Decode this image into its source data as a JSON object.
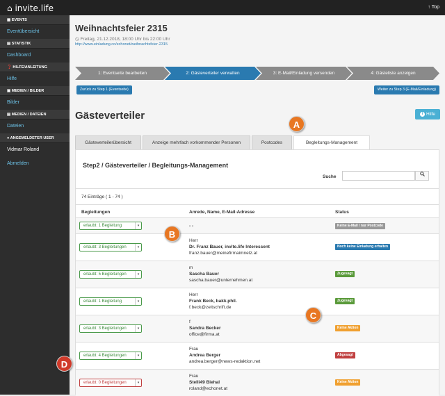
{
  "app": {
    "logo": "invite.life",
    "top_link": "Top"
  },
  "sidebar": {
    "sections": [
      {
        "header": "EVENTS",
        "items": [
          "Eventübersicht"
        ]
      },
      {
        "header": "STATISTIK",
        "items": [
          "Dashboard"
        ]
      },
      {
        "header": "HILFE/ANLEITUNG",
        "items": [
          "Hilfe"
        ]
      },
      {
        "header": "MEDIEN / BILDER",
        "items": [
          "Bilder"
        ]
      },
      {
        "header": "MEDIEN / DATEIEN",
        "items": [
          "Dateien"
        ]
      },
      {
        "header": "ANGEMELDETER USER",
        "items": [
          "Vidmar Roland",
          "Abmelden"
        ]
      }
    ]
  },
  "event": {
    "title": "Weihnachtsfeier 2315",
    "date": "Freitag, 21.12.2018, 18:00 Uhr bis 22:00 Uhr",
    "url": "http://www.einladung.co/echonet/weihnachtsfeier-2315"
  },
  "steps": [
    {
      "label": "1: Eventseite bearbeiten",
      "active": false
    },
    {
      "label": "2: Gästeverteiler verwalten",
      "active": true
    },
    {
      "label": "3: E-Mail/Einladung versenden",
      "active": false
    },
    {
      "label": "4: Gästeliste anzeigen",
      "active": false
    }
  ],
  "nav": {
    "back": "Zurück zu Step 1 (Eventseite)",
    "next": "Weiter zu Step 3 (E-Mail/Einladung)"
  },
  "section_title": "Gästeverteiler",
  "help_label": "Hilfe",
  "tabs": [
    "Gästeverteilerübersicht",
    "Anzeige mehrfach vorkommender Personen",
    "Postcodes",
    "Begleitungs-Management"
  ],
  "panel": {
    "title": "Step2 / Gästeverteiler / Begleitungs-Management",
    "search_label": "Suche",
    "count": "74 Einträge ( 1 - 74 )",
    "headers": [
      "Begleitungen",
      "Anrede, Name, E-Mail-Adresse",
      "Status"
    ]
  },
  "rows": [
    {
      "select": "erlaubt: 1 Begleitung",
      "select_color": "green",
      "lines": [
        "- -"
      ],
      "status": "Keine E-Mail / nur Postcode",
      "status_color": "gray"
    },
    {
      "select": "erlaubt: 3 Begleitungen",
      "select_color": "green",
      "lines": [
        "Herr",
        "Dr. Franz Bauer, invite.life Interessent",
        "franz.bauer@meinefirmaimnetz.at"
      ],
      "status": "Noch keine Einladung erhalten",
      "status_color": "blue"
    },
    {
      "select": "erlaubt: 5 Begleitungen",
      "select_color": "green",
      "lines": [
        "m",
        "Sascha Bauer",
        "sascha.bauer@unternehmen.at"
      ],
      "status": "Zugesagt",
      "status_color": "green"
    },
    {
      "select": "erlaubt: 1 Begleitung",
      "select_color": "green",
      "lines": [
        "Herr",
        "Frank Beck, bakk.phil.",
        "f.beck@zeitschrift.de"
      ],
      "status": "Zugesagt",
      "status_color": "green"
    },
    {
      "select": "erlaubt: 3 Begleitungen",
      "select_color": "green",
      "lines": [
        "f",
        "Sandra Becker",
        "office@firma.at"
      ],
      "status": "Keine Aktion",
      "status_color": "orange"
    },
    {
      "select": "erlaubt: 4 Begleitungen",
      "select_color": "green",
      "lines": [
        "Frau",
        "Andrea Berger",
        "andrea.berger@news-redaktion.net"
      ],
      "status": "Abgesagt",
      "status_color": "red"
    },
    {
      "select": "erlaubt: 0 Begleitungen",
      "select_color": "red",
      "lines": [
        "Frau",
        "Stelli49 Biehal",
        "roland@echonet.at"
      ],
      "status": "Keine Aktion",
      "status_color": "orange"
    }
  ],
  "markers": [
    "A",
    "B",
    "C",
    "D"
  ]
}
